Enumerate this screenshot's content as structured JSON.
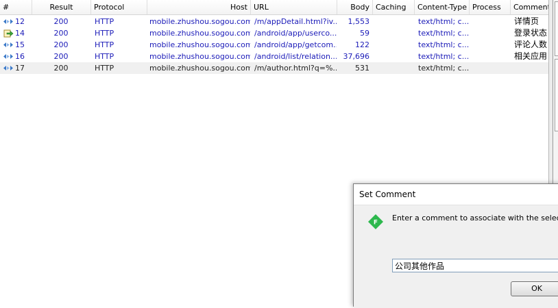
{
  "columns": [
    {
      "key": "num",
      "label": "#"
    },
    {
      "key": "result",
      "label": "Result"
    },
    {
      "key": "protocol",
      "label": "Protocol"
    },
    {
      "key": "host",
      "label": "Host"
    },
    {
      "key": "url",
      "label": "URL"
    },
    {
      "key": "body",
      "label": "Body"
    },
    {
      "key": "caching",
      "label": "Caching"
    },
    {
      "key": "content_type",
      "label": "Content-Type"
    },
    {
      "key": "process",
      "label": "Process"
    },
    {
      "key": "comments",
      "label": "Comments"
    }
  ],
  "sessions": [
    {
      "num": "12",
      "result": "200",
      "protocol": "HTTP",
      "host": "mobile.zhushou.sogou.com",
      "url": "/m/appDetail.html?iv...",
      "body": "1,553",
      "caching": "",
      "content_type": "text/html; c...",
      "process": "",
      "comments": "详情页",
      "icon": "get-arrows-icon",
      "style": "blue"
    },
    {
      "num": "14",
      "result": "200",
      "protocol": "HTTP",
      "host": "mobile.zhushou.sogou.com",
      "url": "/android/app/userco...",
      "body": "59",
      "caching": "",
      "content_type": "text/html; c...",
      "process": "",
      "comments": "登录状态",
      "icon": "post-arrow-icon",
      "style": "blue"
    },
    {
      "num": "15",
      "result": "200",
      "protocol": "HTTP",
      "host": "mobile.zhushou.sogou.com",
      "url": "/android/app/getcom...",
      "body": "122",
      "caching": "",
      "content_type": "text/html; c...",
      "process": "",
      "comments": "评论人数",
      "icon": "get-arrows-icon",
      "style": "blue"
    },
    {
      "num": "16",
      "result": "200",
      "protocol": "HTTP",
      "host": "mobile.zhushou.sogou.com",
      "url": "/android/list/relation....",
      "body": "37,696",
      "caching": "",
      "content_type": "text/html; c...",
      "process": "",
      "comments": "相关应用",
      "icon": "get-arrows-icon",
      "style": "blue"
    },
    {
      "num": "17",
      "result": "200",
      "protocol": "HTTP",
      "host": "mobile.zhushou.sogou.com",
      "url": "/m/author.html?q=%...",
      "body": "531",
      "caching": "",
      "content_type": "text/html; c...",
      "process": "",
      "comments": "",
      "icon": "get-arrows-icon",
      "style": "dark",
      "selected": true
    }
  ],
  "dialog": {
    "title": "Set Comment",
    "prompt": "Enter a comment to associate with the selected Se",
    "icon_letter": "F",
    "input_value": "公司其他作品",
    "ok_label": "OK"
  },
  "colors": {
    "link_blue": "#1a1ab8",
    "selected_row": "#f0f0f0",
    "fiddler_green": "#2db84d"
  }
}
